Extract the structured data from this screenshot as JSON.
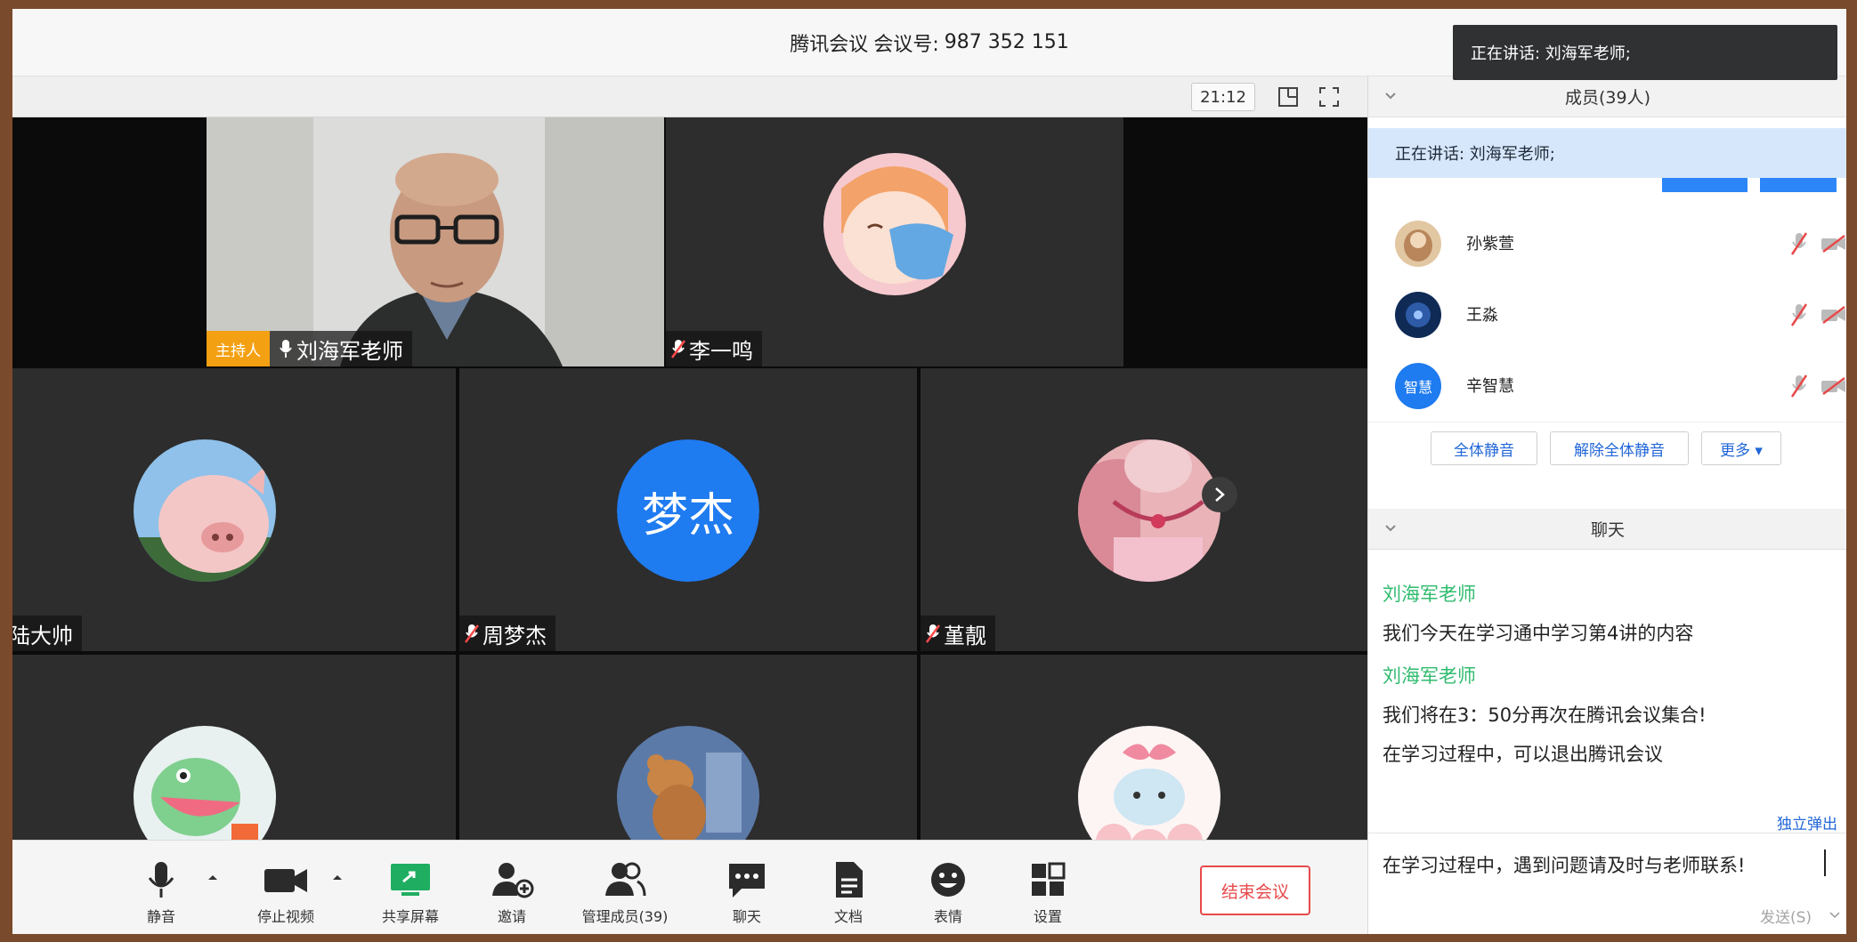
{
  "title": {
    "app": "腾讯会议",
    "meeting_label": "会议号:",
    "meeting_id": "987 352 151"
  },
  "toast": "正在讲话: 刘海军老师;",
  "video_header": {
    "clock": "21:12"
  },
  "tiles": [
    {
      "name": "刘海军老师",
      "host_badge": "主持人"
    },
    {
      "name": "李一鸣"
    },
    {
      "name": "陆大帅"
    },
    {
      "name": "周梦杰",
      "avatar_text": "梦杰",
      "avatar_color": "#1f7bf0"
    },
    {
      "name": "堇靓"
    },
    {
      "name": ""
    },
    {
      "name": ""
    },
    {
      "name": ""
    }
  ],
  "toolbar": {
    "mute": "静音",
    "stop_video": "停止视频",
    "share_screen": "共享屏幕",
    "invite": "邀请",
    "manage_members": "管理成员(39)",
    "chat": "聊天",
    "docs": "文档",
    "emoji": "表情",
    "settings": "设置",
    "end_meeting": "结束会议"
  },
  "members_panel": {
    "header": "成员(39人)",
    "speaking": "正在讲话: 刘海军老师;",
    "members": [
      {
        "name": "孙紫萱"
      },
      {
        "name": "王淼"
      },
      {
        "name": "辛智慧",
        "avatar_text": "智慧"
      }
    ],
    "actions": {
      "mute_all": "全体静音",
      "unmute_all": "解除全体静音",
      "more": "更多 ▾"
    }
  },
  "chat_panel": {
    "header": "聊天",
    "messages": [
      {
        "sender": "刘海军老师",
        "text": "我们今天在学习通中学习第4讲的内容"
      },
      {
        "sender": "刘海军老师",
        "text": "我们将在3：50分再次在腾讯会议集合!"
      },
      {
        "text": "在学习过程中，可以退出腾讯会议"
      }
    ],
    "popout": "独立弹出",
    "input": "在学习过程中，遇到问题请及时与老师联系!",
    "send": "发送(S)"
  },
  "colors": {
    "accent_blue": "#2d86f7",
    "sender_green": "#2fbb6e",
    "end_red": "#e8494a",
    "host_orange": "#f3a012",
    "share_green": "#1fae61"
  },
  "icons": [
    "mic-icon",
    "video-camera-icon",
    "share-screen-icon",
    "invite-icon",
    "members-icon",
    "chat-icon",
    "document-icon",
    "emoji-icon",
    "settings-icon",
    "layout-icon",
    "fullscreen-icon"
  ]
}
